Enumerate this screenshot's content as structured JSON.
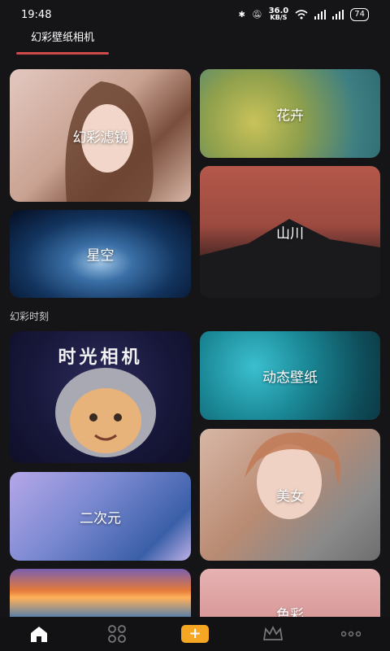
{
  "status_bar": {
    "time": "19:48",
    "net_speed": "36.0",
    "net_unit": "KB/S",
    "battery": "74",
    "icons": [
      "bluetooth-icon",
      "mute-icon",
      "wifi-icon",
      "signal-icon",
      "signal-icon"
    ]
  },
  "header": {
    "tab_label": "幻彩壁纸相机"
  },
  "featured": {
    "card1": "幻彩滤镜",
    "card2": "花卉",
    "card3": "星空",
    "card4": "山川"
  },
  "section": {
    "title": "幻彩时刻",
    "card1_title_art": "时光相机",
    "card2": "动态壁纸",
    "card3": "二次元",
    "card4": "美女",
    "card6": "色彩"
  },
  "bottom_nav": {
    "items": [
      "home-icon",
      "grid-icon",
      "add-icon",
      "crown-icon",
      "more-icon"
    ],
    "accent": "#f5a623"
  }
}
